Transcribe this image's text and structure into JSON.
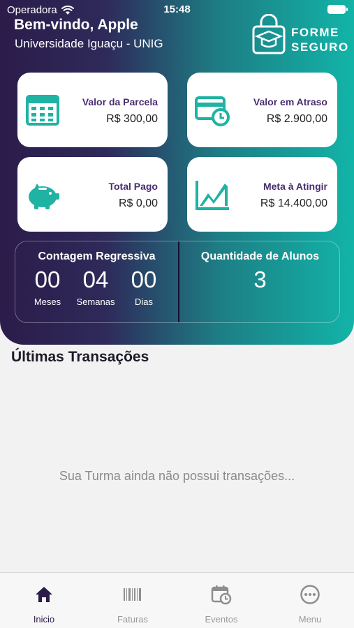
{
  "status_bar": {
    "carrier": "Operadora",
    "time": "15:48"
  },
  "header": {
    "greeting": "Bem-vindo, Apple",
    "university": "Universidade Iguaçu - UNIG",
    "logo_line1": "FORME",
    "logo_line2": "SEGURO"
  },
  "cards": [
    {
      "label": "Valor da Parcela",
      "value": "R$ 300,00",
      "icon": "calculator-icon"
    },
    {
      "label": "Valor em Atraso",
      "value": "R$ 2.900,00",
      "icon": "card-clock-icon"
    },
    {
      "label": "Total Pago",
      "value": "R$ 0,00",
      "icon": "piggy-bank-icon"
    },
    {
      "label": "Meta à Atingir",
      "value": "R$ 14.400,00",
      "icon": "chart-icon"
    }
  ],
  "countdown": {
    "title": "Contagem Regressiva",
    "units": [
      {
        "value": "00",
        "label": "Meses"
      },
      {
        "value": "04",
        "label": "Semanas"
      },
      {
        "value": "00",
        "label": "Dias"
      }
    ]
  },
  "students": {
    "title": "Quantidade de Alunos",
    "count": "3"
  },
  "transactions": {
    "title": "Últimas Transações",
    "empty_message": "Sua Turma ainda não possui transações..."
  },
  "tabbar": {
    "items": [
      {
        "label": "Inicio",
        "icon": "home-icon",
        "active": true
      },
      {
        "label": "Faturas",
        "icon": "barcode-icon",
        "active": false
      },
      {
        "label": "Eventos",
        "icon": "calendar-clock-icon",
        "active": false
      },
      {
        "label": "Menu",
        "icon": "more-icon",
        "active": false
      }
    ]
  },
  "colors": {
    "accent_dark": "#2b1c4a",
    "accent_teal": "#12b4a8",
    "card_label": "#4a2d6e"
  }
}
